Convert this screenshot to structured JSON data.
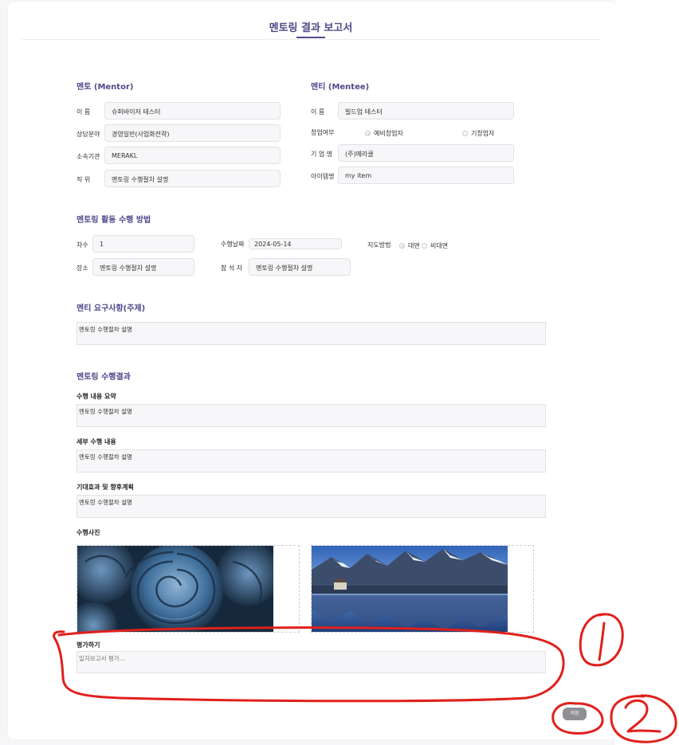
{
  "header": {
    "title": "멘토링 결과 보고서"
  },
  "mentor": {
    "heading": "멘토 (Mentor)",
    "name_label": "이    름",
    "name_value": "슈퍼바이저 테스터",
    "field_label": "상담분야",
    "field_value": "경영일반(사업화전략)",
    "org_label": "소속기관",
    "org_value": "MERAKL",
    "position_label": "직    위",
    "position_value": "멘토링 수행절차 설명"
  },
  "mentee": {
    "heading": "멘티 (Mentee)",
    "name_label": "이    름",
    "name_value": "빌드업 테스터",
    "startup_label": "창업여부",
    "startup_options": [
      "예비창업자",
      "기창업자"
    ],
    "company_label": "기 업 명",
    "company_value": "(주)메라클",
    "item_label": "아이템명",
    "item_value": "my item"
  },
  "activity": {
    "heading": "멘토링 활동 수행 방법",
    "round_label": "차수",
    "round_value": "1",
    "date_label": "수행날짜",
    "date_value": "2024-05-14",
    "method_label": "지도방법",
    "method_options": [
      "대면",
      "비대면"
    ],
    "place_label": "장소",
    "place_value": "멘토링 수행절차 설명",
    "attendee_label": "참 석 자",
    "attendee_value": "멘토링 수행절차 설명"
  },
  "request": {
    "heading": "멘티 요구사항(주제)",
    "value": "멘토링 수행절차 설명"
  },
  "result": {
    "heading": "멘토링 수행결과",
    "summary_label": "수행 내용 요약",
    "summary_value": "멘토링 수행절차 설명",
    "detail_label": "세부 수행 내용",
    "detail_value": "멘토링 수행절차 설명",
    "plan_label": "기대효과 및 향후계획",
    "plan_value": "멘토링 수행절차 설명",
    "photos_label": "수행사진"
  },
  "evaluation": {
    "label": "평가하기",
    "placeholder": "일지보고서 평가..."
  },
  "actions": {
    "save_label": "저장"
  },
  "annotations": {
    "mark_1": "1",
    "mark_2": "2",
    "color": "#e0201c"
  },
  "colors": {
    "accent": "#4e4a8a",
    "button": "#8f8f94"
  }
}
